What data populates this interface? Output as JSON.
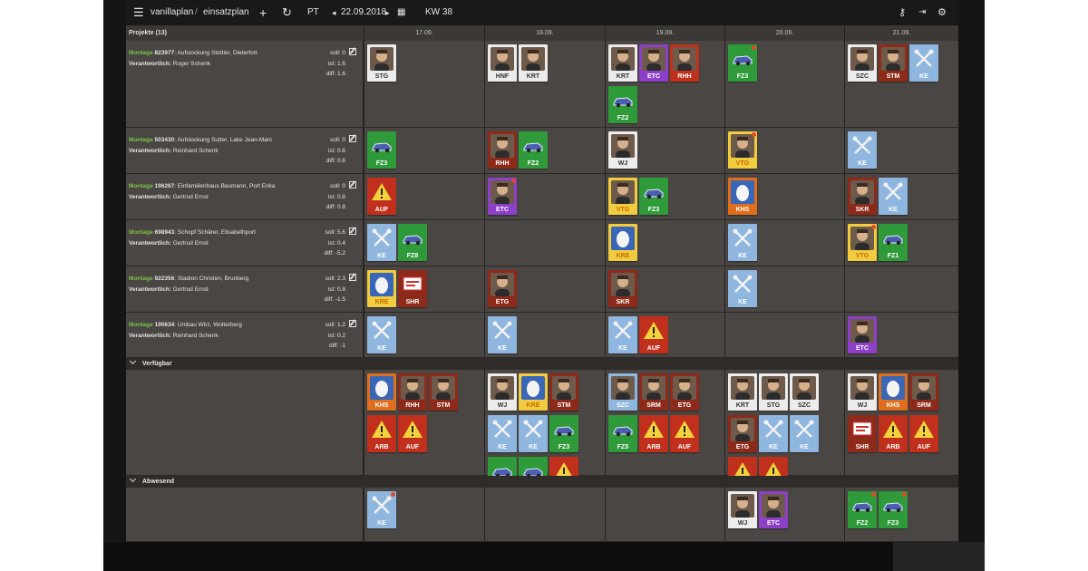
{
  "app": {
    "crumb_app": "vanillaplan",
    "crumb_sep": "/",
    "crumb_page": "einsatzplan",
    "plus": "+",
    "refresh": "↻",
    "view_mode": "PT",
    "prev": "◂",
    "date": "22.09.2018",
    "next": "▸",
    "week": "KW 38"
  },
  "columns": {
    "projects_label": "Projekte (13)",
    "days": [
      "17.09.",
      "18.09.",
      "19.09.",
      "20.09.",
      "21.09."
    ]
  },
  "projects": [
    {
      "type": "Montage",
      "num": "823977",
      "desc": "Aufstockung Stettler, Dieterfort",
      "resp_label": "Verantwortlich:",
      "resp": "Roger Schenk",
      "soll": "soll: 0",
      "ist": "ist: 1.6",
      "diff": "diff: 1.6"
    },
    {
      "type": "Montage",
      "num": "503430",
      "desc": "Aufstockung Sutter, Lake Jean-Marc",
      "resp_label": "Verantwortlich:",
      "resp": "Reinhard Schenk",
      "soll": "soll: 0",
      "ist": "ist: 0.6",
      "diff": "diff: 0.6"
    },
    {
      "type": "Montage",
      "num": "196267",
      "desc": "Einfamilienhaus Baumann, Port Erika",
      "resp_label": "Verantwortlich:",
      "resp": "Gertrud Ernst",
      "soll": "soll: 0",
      "ist": "ist: 0.8",
      "diff": "diff: 0.8"
    },
    {
      "type": "Montage",
      "num": "698943",
      "desc": "Schopf Schärer, Elisabethport",
      "resp_label": "Verantwortlich:",
      "resp": "Gertrud Ernst",
      "soll": "soll: 5.6",
      "ist": "ist: 0.4",
      "diff": "diff: -5.2"
    },
    {
      "type": "Montage",
      "num": "922356",
      "desc": "Stadion Christen, Brunberg",
      "resp_label": "Verantwortlich:",
      "resp": "Gertrud Ernst",
      "soll": "soll: 2.3",
      "ist": "ist: 0.8",
      "diff": "diff: -1.5"
    },
    {
      "type": "Montage",
      "num": "190634",
      "desc": "Umbau Wirz, Wolterberg",
      "resp_label": "Verantwortlich:",
      "resp": "Reinhard Schenk",
      "soll": "soll: 1.2",
      "ist": "ist: 0.2",
      "diff": "diff: -1"
    }
  ],
  "sections": {
    "available": "Verfügbar",
    "absent": "Abwesend"
  },
  "colors": {
    "red": "#c0301c",
    "orange": "#e06e1c",
    "green": "#2f9a3a",
    "blue": "#8fb6de",
    "yellow": "#f1cc3f",
    "purple": "#8d3fc7",
    "white": "#ececec",
    "darkred": "#8e2a1a"
  }
}
